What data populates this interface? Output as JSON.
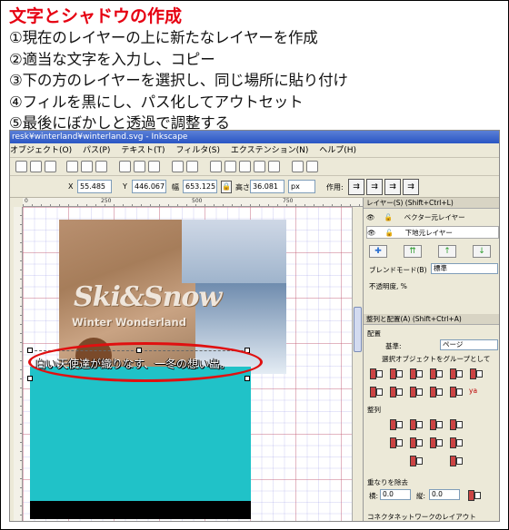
{
  "instructions": {
    "title": "文字とシャドウの作成",
    "steps": [
      "①現在のレイヤーの上に新たなレイヤーを作成",
      "②適当な文字を入力し、コピー",
      "③下の方のレイヤーを選択し、同じ場所に貼り付け",
      "④フィルを黒にし、パス化してアウトセット",
      "⑤最後にぼかしと透過で調整する"
    ]
  },
  "window": {
    "title": "resk¥winterland¥winterland.svg - Inkscape",
    "menu": [
      "オブジェクト(O)",
      "パス(P)",
      "テキスト(T)",
      "フィルタ(S)",
      "エクステンション(N)",
      "ヘルプ(H)"
    ]
  },
  "toolbar": {
    "x_label": "X",
    "x_value": "55.485",
    "y_label": "Y",
    "y_value": "446.067",
    "w_label": "幅",
    "w_value": "653.125",
    "h_label": "高さ",
    "h_value": "36.081",
    "unit": "px",
    "affect_label": "作用:"
  },
  "ruler": {
    "ticks": [
      "0",
      "250",
      "500",
      "750"
    ]
  },
  "canvas": {
    "logo": "Ski&Snow",
    "subtitle": "Winter Wonderland",
    "caption": "白い天使達が織りなす、一冬の想い出。"
  },
  "layers_panel": {
    "title": "レイヤー(S) (Shift+Ctrl+L)",
    "layers": [
      "ベクター元レイヤー",
      "下地元レイヤー"
    ],
    "blend_label": "ブレンドモード(B)",
    "blend_value": "標準",
    "opacity_label": "不透明度, %"
  },
  "align_panel": {
    "title": "整列と配置(A) (Shift+Ctrl+A)",
    "align_section": "配置",
    "relative_label": "基準:",
    "relative_value": "ページ",
    "group_label": "選択オブジェクトをグループとして",
    "distribute_section": "整列",
    "remove_overlap_section": "重なりを除去",
    "h_label": "横:",
    "h_value": "0.0",
    "v_label": "縦:",
    "v_value": "0.0",
    "connector_section": "コネクタネットワークのレイアウト"
  }
}
